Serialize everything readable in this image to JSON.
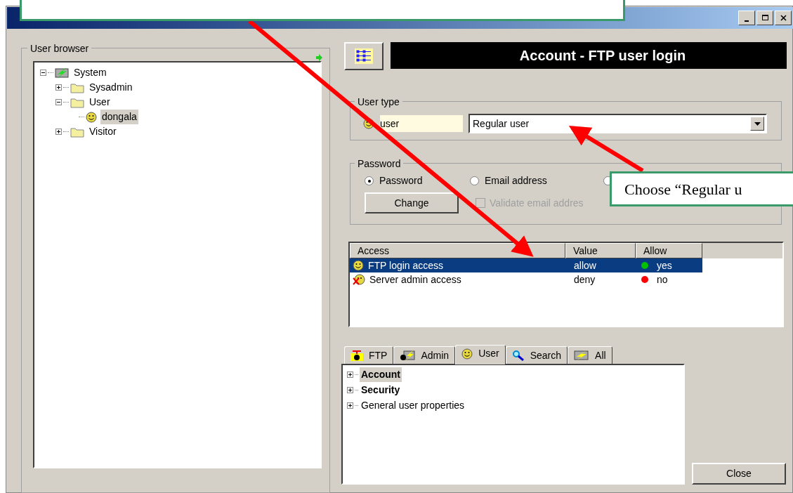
{
  "user_browser": {
    "title": "User browser",
    "tree": [
      {
        "label": "System",
        "kind": "system",
        "expanded": true,
        "selected": false,
        "children": [
          {
            "label": "Sysadmin",
            "kind": "folder",
            "expanded": false,
            "selected": false
          },
          {
            "label": "User",
            "kind": "folder",
            "expanded": true,
            "selected": false,
            "children": [
              {
                "label": "dongala",
                "kind": "user",
                "selected": true
              }
            ]
          },
          {
            "label": "Visitor",
            "kind": "folder",
            "expanded": false,
            "selected": false
          }
        ]
      }
    ]
  },
  "header": {
    "title": "Account - FTP user login"
  },
  "user_type": {
    "title": "User type",
    "field": "user",
    "value": "Regular user"
  },
  "password": {
    "title": "Password",
    "options": [
      {
        "label": "Password",
        "selected": true
      },
      {
        "label": "Email address",
        "selected": false
      },
      {
        "selected": false
      }
    ],
    "change_button": "Change",
    "validate": {
      "label": "Validate email addres",
      "checked": false,
      "disabled": true
    }
  },
  "access": {
    "columns": [
      "Access",
      "Value",
      "Allow"
    ],
    "rows": [
      {
        "name": "FTP login access",
        "kind": "allow",
        "value": "allow",
        "allow": "yes",
        "color": "#00c000",
        "selected": true
      },
      {
        "name": "Server admin access",
        "kind": "deny",
        "value": "deny",
        "allow": "no",
        "color": "#ff0000",
        "selected": false
      }
    ]
  },
  "tabs": [
    {
      "label": "FTP",
      "kind": "ftp",
      "selected": false
    },
    {
      "label": "Admin",
      "kind": "admin",
      "selected": false
    },
    {
      "label": "User",
      "kind": "user",
      "selected": true
    },
    {
      "label": "Search",
      "kind": "search",
      "selected": false
    },
    {
      "label": "All",
      "kind": "all",
      "selected": false
    }
  ],
  "properties": [
    {
      "label": "Account",
      "bold": true,
      "selected": true
    },
    {
      "label": "Security",
      "bold": true,
      "selected": false
    },
    {
      "label": "General user properties",
      "bold": false,
      "selected": false
    }
  ],
  "close_button": "Close",
  "callout": {
    "text": "Choose “Regular u"
  }
}
